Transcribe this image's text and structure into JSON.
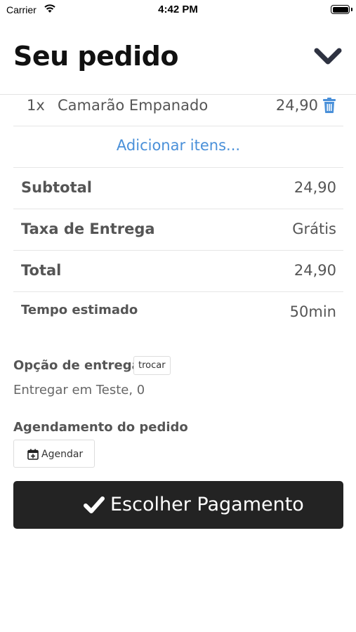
{
  "status_bar": {
    "carrier": "Carrier",
    "time": "4:42 PM"
  },
  "header": {
    "title": "Seu pedido",
    "collapse_icon": "chevron-down-icon"
  },
  "cart": {
    "items": [
      {
        "qty": "1x",
        "name": "Camarão Empanado",
        "price": "24,90",
        "remove_icon": "trash-icon"
      }
    ],
    "add_items_label": "Adicionar itens..."
  },
  "summary": {
    "subtotal_label": "Subtotal",
    "subtotal_value": "24,90",
    "delivery_fee_label": "Taxa de Entrega",
    "delivery_fee_value": "Grátis",
    "total_label": "Total",
    "total_value": "24,90",
    "eta_label": "Tempo estimado",
    "eta_value": "50min"
  },
  "delivery": {
    "label": "Opção de entrega",
    "swap_label": "trocar",
    "address": "Entregar em Teste, 0"
  },
  "scheduling": {
    "label": "Agendamento do pedido",
    "button_label": "Agendar",
    "button_icon": "calendar-plus-icon"
  },
  "payment": {
    "button_label": "Escolher Pagamento",
    "button_icon": "check-icon"
  },
  "colors": {
    "link": "#4a90d9",
    "primary_button": "#232323"
  }
}
